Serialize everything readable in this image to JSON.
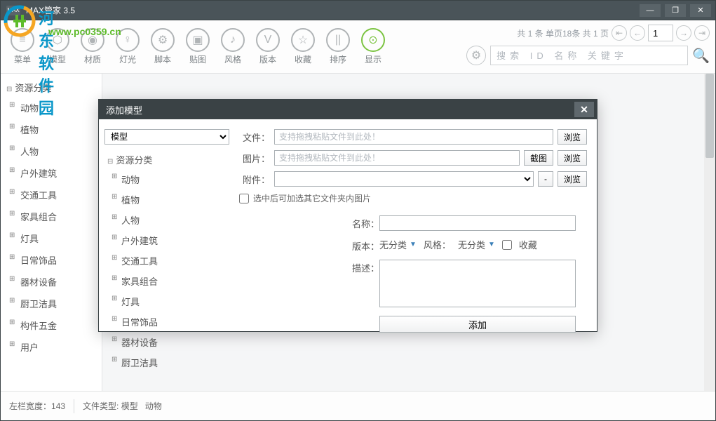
{
  "window": {
    "title": "MAX管家 3.5",
    "logo_text": "MAX"
  },
  "watermark": {
    "text1": "河东软件园",
    "text2": "www.pc0359.cn"
  },
  "toolbar": {
    "items": [
      {
        "label": "菜单",
        "icon": "≡"
      },
      {
        "label": "模型",
        "icon": "⬡"
      },
      {
        "label": "材质",
        "icon": "◉"
      },
      {
        "label": "灯光",
        "icon": "♀"
      },
      {
        "label": "脚本",
        "icon": "⚙"
      },
      {
        "label": "贴图",
        "icon": "▣"
      },
      {
        "label": "风格",
        "icon": "♪"
      },
      {
        "label": "版本",
        "icon": "V"
      },
      {
        "label": "收藏",
        "icon": "☆"
      },
      {
        "label": "排序",
        "icon": "||",
        "green": false
      },
      {
        "label": "显示",
        "icon": "⊙",
        "green": true
      }
    ]
  },
  "pager": {
    "info": "共 1 条 单页18条 共 1 页",
    "value": "1"
  },
  "search": {
    "placeholder": "搜索 ID 名称 关键字"
  },
  "sidebar": {
    "root": "资源分类",
    "items": [
      "动物",
      "植物",
      "人物",
      "户外建筑",
      "交通工具",
      "家具组合",
      "灯具",
      "日常饰品",
      "器材设备",
      "厨卫洁具",
      "构件五金",
      "用户"
    ]
  },
  "status": {
    "left_width_label": "左栏宽度：",
    "left_width_value": "143",
    "file_type_label": "文件类型:",
    "file_type_value": "模型",
    "category": "动物"
  },
  "modal": {
    "title": "添加模型",
    "type_select": "模型",
    "tree_root": "资源分类",
    "tree_items": [
      "动物",
      "植物",
      "人物",
      "户外建筑",
      "交通工具",
      "家具组合",
      "灯具",
      "日常饰品",
      "器材设备",
      "厨卫洁具"
    ],
    "file_label": "文件：",
    "file_placeholder": "支持拖拽粘贴文件到此处！",
    "image_label": "图片：",
    "image_placeholder": "支持拖拽粘贴文件到此处！",
    "attach_label": "附件：",
    "browse": "浏览",
    "screenshot": "截图",
    "minus": "-",
    "checkbox_label": "选中后可加选其它文件夹内图片",
    "name_label": "名称：",
    "version_label": "版本：",
    "version_value": "无分类",
    "style_label": "风格：",
    "style_value": "无分类",
    "fav_label": "收藏",
    "desc_label": "描述：",
    "add_button": "添加"
  }
}
